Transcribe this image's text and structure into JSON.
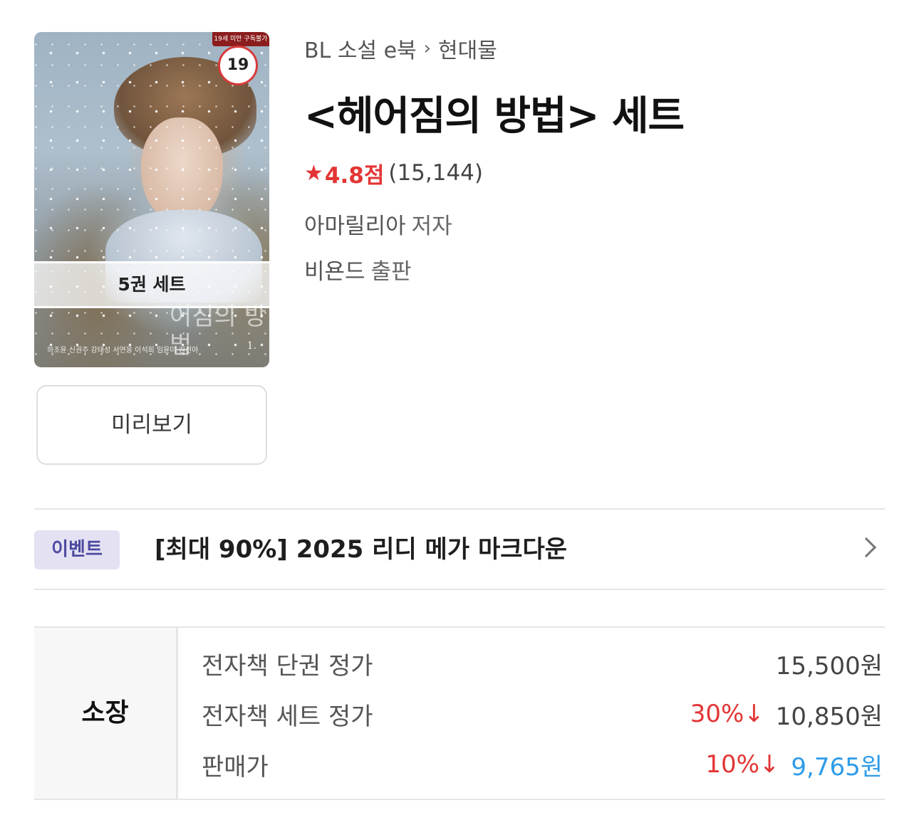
{
  "cover": {
    "age_banner": "19세 미만 구독불가",
    "age_badge": "19",
    "set_label": "5권 세트",
    "title_deco": "어짐의 방법",
    "credits": "하조윤 신권주 강태성 서연웅 이석희 임윤미 김선아",
    "volume": "1."
  },
  "preview_button": "미리보기",
  "breadcrumb": {
    "category": "BL 소설 e북",
    "separator": "›",
    "subcategory": "현대물"
  },
  "title": "<헤어짐의 방법> 세트",
  "rating": {
    "star_icon": "star-icon",
    "score": "4.8점",
    "count": "(15,144)"
  },
  "author": {
    "name": "아마릴리아",
    "role": "저자"
  },
  "publisher": {
    "name": "비욘드",
    "role": "출판"
  },
  "event": {
    "tag": "이벤트",
    "text": "[최대 90%] 2025 리디 메가 마크다운"
  },
  "price": {
    "header": "소장",
    "rows": [
      {
        "label": "전자책 단권 정가",
        "discount": "",
        "amount": "15,500원"
      },
      {
        "label": "전자책 세트 정가",
        "discount": "30%↓",
        "amount": "10,850원"
      },
      {
        "label": "판매가",
        "discount": "10%↓",
        "amount": "9,765원"
      }
    ]
  },
  "colors": {
    "accent_red": "#e33535",
    "price_blue": "#2d9be8",
    "event_tag_bg": "#e4e1f3",
    "event_tag_text": "#4d4aa0"
  }
}
